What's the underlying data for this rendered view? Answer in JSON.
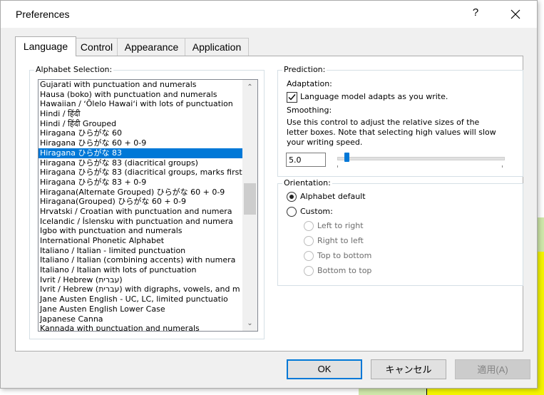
{
  "window": {
    "title": "Preferences",
    "help_glyph": "?"
  },
  "tabs": [
    {
      "label": "Language",
      "active": true
    },
    {
      "label": "Control",
      "active": false
    },
    {
      "label": "Appearance",
      "active": false
    },
    {
      "label": "Application",
      "active": false
    }
  ],
  "alphabet": {
    "label": "Alphabet Selection:",
    "items": [
      "Gujarati with punctuation and numerals",
      "Hausa (boko) with punctuation and numerals",
      "Hawaiian / ʻŌlelo Hawaiʻi with lots of punctuation",
      "Hindi / हिंदी",
      "Hindi / हिंदी Grouped",
      "Hiragana ひらがな 60",
      "Hiragana ひらがな 60 + 0-9",
      "Hiragana ひらがな 83",
      "Hiragana ひらがな 83 (diacritical groups)",
      "Hiragana ひらがな 83 (diacritical groups, marks first",
      "Hiragana ひらがな 83 + 0-9",
      "Hiragana(Alternate Grouped) ひらがな 60 + 0-9",
      "Hiragana(Grouped) ひらがな 60 + 0-9",
      "Hrvatski / Croatian with punctuation and numera",
      "Icelandic / Íslensku with punctuation and numera",
      "Igbo with punctuation and numerals",
      "International Phonetic Alphabet",
      "Italiano / Italian - limited punctuation",
      "Italiano / Italian (combining accents) with numera",
      "Italiano / Italian with lots of punctuation",
      "Ivrit / Hebrew (עברית)",
      "Ivrit / Hebrew (עברית) with digraphs, vowels, and m",
      "Jane Austen English - UC, LC, limited punctuatio",
      "Jane Austen English Lower Case",
      "Japanese Canna",
      "Kannada with punctuation and numerals"
    ],
    "selected_index": 7,
    "scroll_up": "⌃",
    "scroll_down": "⌄"
  },
  "prediction": {
    "label": "Prediction:",
    "adaptation_label": "Adaptation:",
    "adapt_checkbox_label": "Language model adapts as you write.",
    "adapt_checked": true,
    "smoothing_label": "Smoothing:",
    "smoothing_desc_1": "Use this control to adjust the relative sizes of the",
    "smoothing_desc_2": "letter boxes. Note that selecting high values will slow",
    "smoothing_desc_3": "your writing speed.",
    "smoothing_value": "5.0"
  },
  "orientation": {
    "label": "Orientation:",
    "alphabet_default": "Alphabet default",
    "custom": "Custom:",
    "left_to_right": "Left to right",
    "right_to_left": "Right to left",
    "top_to_bottom": "Top to bottom",
    "bottom_to_top": "Bottom to top"
  },
  "buttons": {
    "ok": "OK",
    "cancel": "キャンセル",
    "apply": "適用(A)"
  }
}
